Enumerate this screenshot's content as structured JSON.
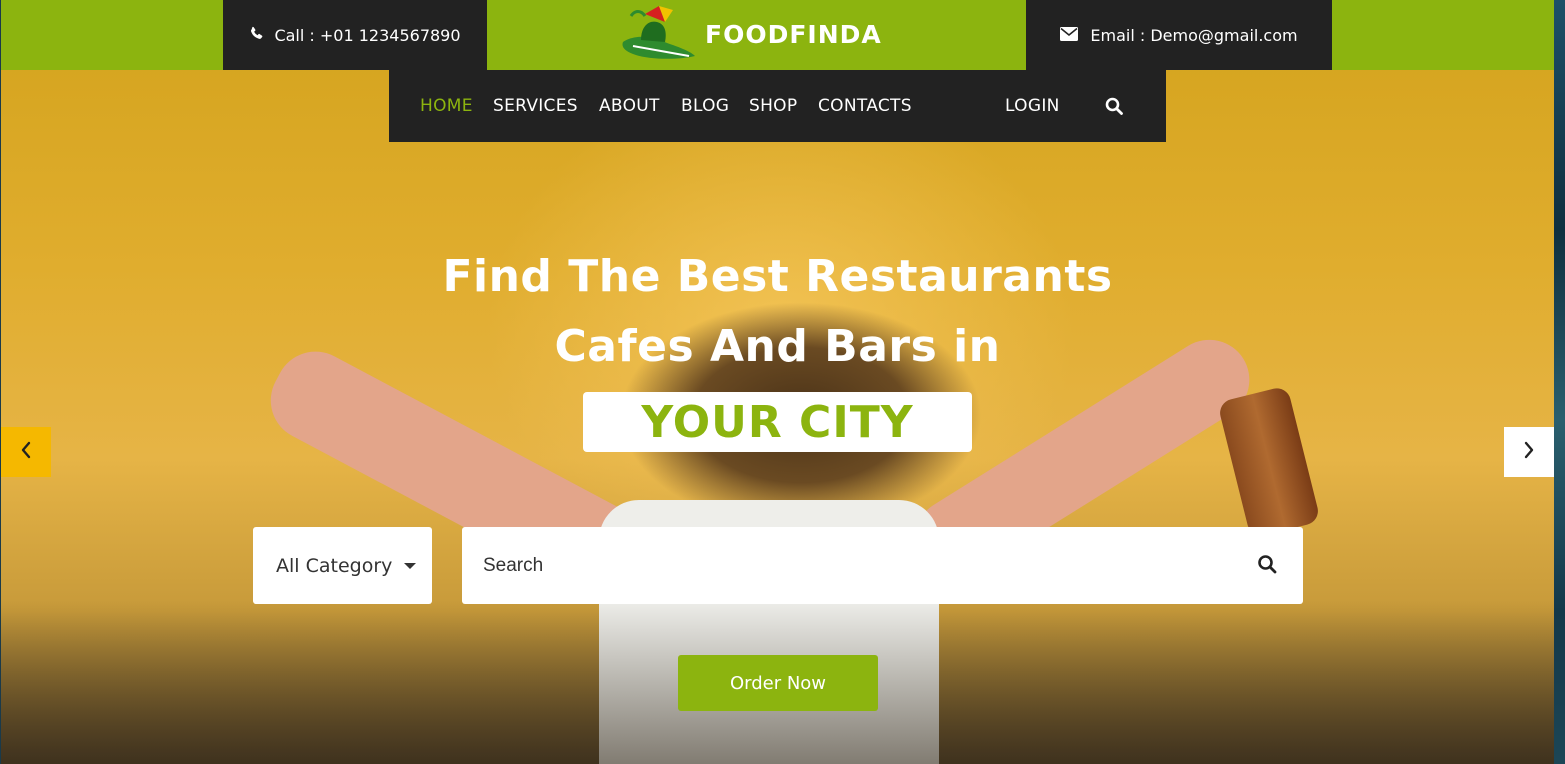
{
  "topbar": {
    "call_text": "Call : +01 1234567890",
    "email_text": "Email : Demo@gmail.com",
    "brand_name": "FOODFINDA",
    "phone_icon": "phone-icon",
    "email_icon": "envelope-icon"
  },
  "nav": {
    "items": [
      {
        "label": "HOME",
        "active": true
      },
      {
        "label": "SERVICES",
        "active": false
      },
      {
        "label": "ABOUT",
        "active": false
      },
      {
        "label": "BLOG",
        "active": false
      },
      {
        "label": "SHOP",
        "active": false
      },
      {
        "label": "CONTACTS",
        "active": false
      }
    ],
    "login_label": "LOGIN",
    "search_icon": "search-icon"
  },
  "hero": {
    "line1": "Find The Best Restaurants",
    "line2": "Cafes And Bars in",
    "highlight": "YOUR CITY"
  },
  "search": {
    "category_label": "All Category",
    "placeholder": "Search"
  },
  "cta": {
    "order_label": "Order Now"
  },
  "colors": {
    "brand_green": "#8cb40f",
    "dark": "#222222",
    "prev_arrow": "#f5b800"
  }
}
